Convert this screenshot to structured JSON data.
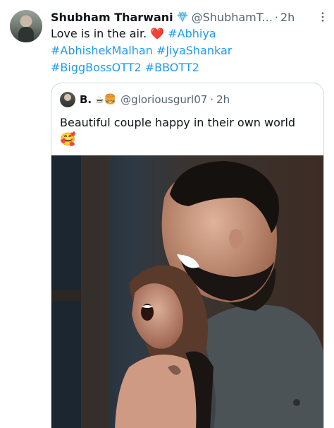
{
  "tweet": {
    "display_name": "Shubham Tharwani",
    "verified_icon": "diamond-badge-icon",
    "handle": "@ShubhamT...",
    "separator": "·",
    "time": "2h",
    "text_line1_plain": "Love is in the air. ",
    "text_line1_heart": "❤️",
    "text_line1_tag": " #Abhiya",
    "hashtags_line2": "#AbhishekMalhan #JiyaShankar",
    "hashtags_line3": "#BiggBossOTT2 #BBOTT2"
  },
  "quote": {
    "display_name": "B.",
    "name_emojis": "☕🍔",
    "handle": "@gloriousgurl07",
    "separator": "·",
    "time": "2h",
    "text": "Beautiful couple happy in their own world",
    "emoji": "🥰"
  },
  "colors": {
    "link": "#1d9bf0",
    "secondary_text": "#536471",
    "border": "#cfd9de",
    "heart": "#e0245e"
  },
  "icons": {
    "more": "more-vertical-icon"
  }
}
